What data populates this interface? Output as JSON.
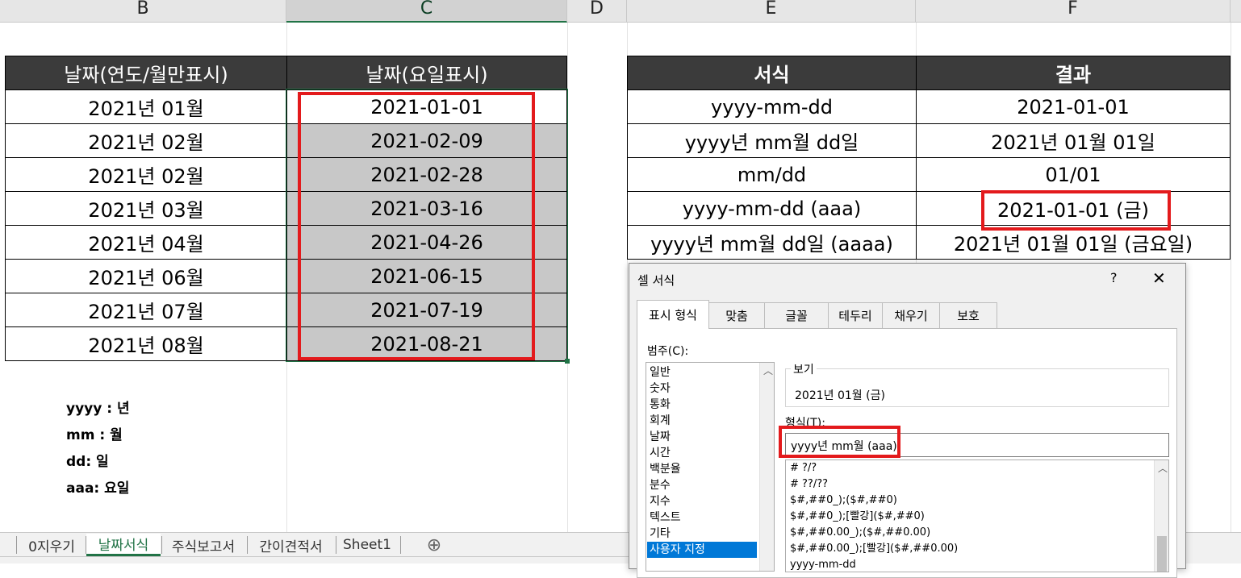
{
  "columns": [
    "B",
    "C",
    "D",
    "E",
    "F"
  ],
  "left_table": {
    "headers": [
      "날짜(연도/월만표시)",
      "날짜(요일표시)"
    ],
    "rows": [
      [
        "2021년 01월",
        "2021-01-01"
      ],
      [
        "2021년 02월",
        "2021-02-09"
      ],
      [
        "2021년 02월",
        "2021-02-28"
      ],
      [
        "2021년 03월",
        "2021-03-16"
      ],
      [
        "2021년 04월",
        "2021-04-26"
      ],
      [
        "2021년 06월",
        "2021-06-15"
      ],
      [
        "2021년 07월",
        "2021-07-19"
      ],
      [
        "2021년 08월",
        "2021-08-21"
      ]
    ]
  },
  "right_table": {
    "headers": [
      "서식",
      "결과"
    ],
    "rows": [
      [
        "yyyy-mm-dd",
        "2021-01-01"
      ],
      [
        "yyyy년 mm월 dd일",
        "2021년 01월 01일"
      ],
      [
        "mm/dd",
        "01/01"
      ],
      [
        "yyyy-mm-dd (aaa)",
        "2021-01-01 (금)"
      ],
      [
        "yyyy년 mm월 dd일 (aaaa)",
        "2021년 01월 01일 (금요일)"
      ]
    ]
  },
  "notes": [
    "yyyy : 년",
    "mm : 월",
    "dd: 일",
    "aaa: 요일"
  ],
  "sheet_tabs": [
    "0지우기",
    "날짜서식",
    "주식보고서",
    "간이견적서",
    "Sheet1"
  ],
  "active_sheet": "날짜서식",
  "add_sheet_icon": "⊕",
  "dialog": {
    "title": "셀 서식",
    "help": "?",
    "close": "✕",
    "tabs": [
      "표시 형식",
      "맞춤",
      "글꼴",
      "테두리",
      "채우기",
      "보호"
    ],
    "category_label": "범주(C):",
    "categories": [
      "일반",
      "숫자",
      "통화",
      "회계",
      "날짜",
      "시간",
      "백분율",
      "분수",
      "지수",
      "텍스트",
      "기타",
      "사용자 지정"
    ],
    "selected_category": "사용자 지정",
    "preview_label": "보기",
    "preview_value": "2021년 01월 (금)",
    "format_label": "형식(T):",
    "format_value": "yyyy년 mm월 (aaa)",
    "format_list": [
      "# ?/?",
      "# ??/??",
      "$#,##0_);($#,##0)",
      "$#,##0_);[빨강]($#,##0)",
      "$#,##0.00_);($#,##0.00)",
      "$#,##0.00_);[빨강]($#,##0.00)",
      "yyyy-mm-dd"
    ]
  },
  "accent_colors": {
    "excel_green": "#217346",
    "highlight_red": "#e31a1c",
    "header_dark": "#3b3b3b",
    "selection_gray": "#c8c8c8"
  }
}
